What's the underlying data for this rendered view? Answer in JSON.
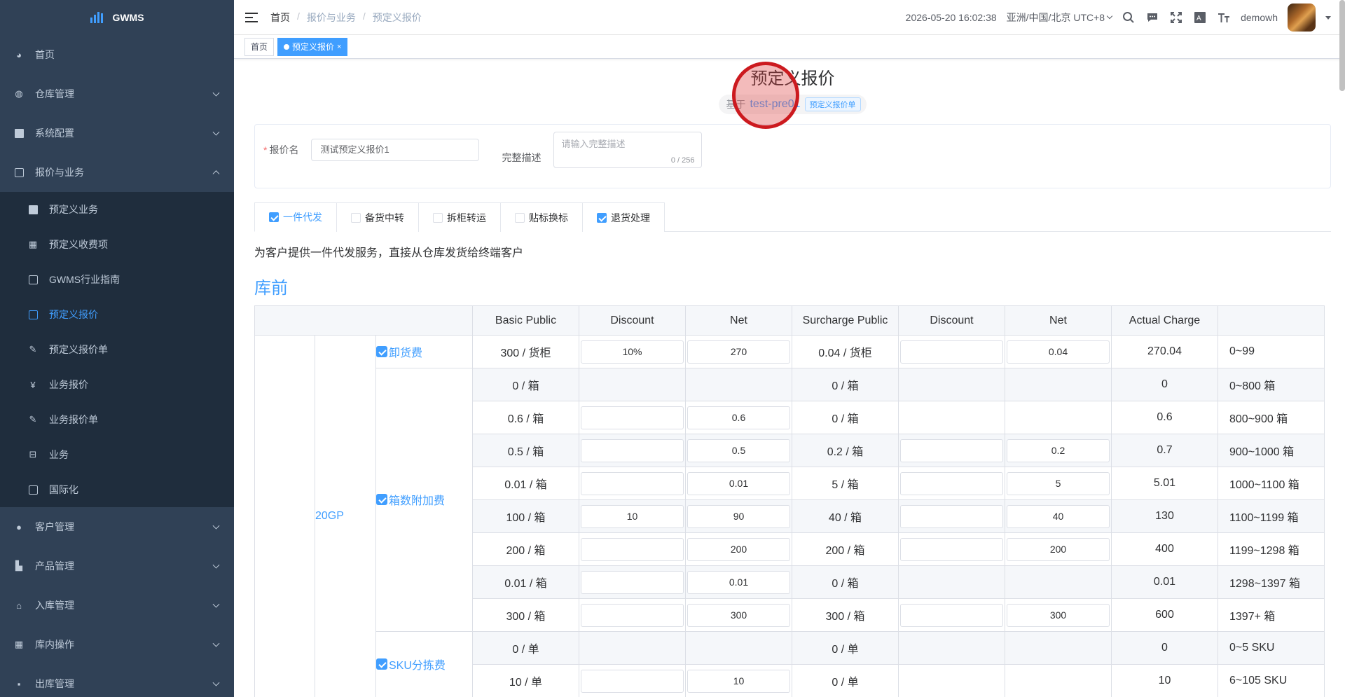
{
  "app": {
    "logo_text": "GWMS"
  },
  "sidebar": {
    "items": [
      {
        "label": "首页",
        "icon": "dashboard-icon",
        "expanded": null
      },
      {
        "label": "仓库管理",
        "icon": "globe-icon",
        "expanded": false
      },
      {
        "label": "系统配置",
        "icon": "server-icon",
        "expanded": false
      },
      {
        "label": "报价与业务",
        "icon": "document-icon",
        "expanded": true
      }
    ],
    "sub_items": [
      {
        "label": "预定义业务",
        "icon": "calendar-icon"
      },
      {
        "label": "预定义收费项",
        "icon": "grid-icon"
      },
      {
        "label": "GWMS行业指南",
        "icon": "document-icon"
      },
      {
        "label": "预定义报价",
        "icon": "document-icon",
        "active": true
      },
      {
        "label": "预定义报价单",
        "icon": "edit-icon"
      },
      {
        "label": "业务报价",
        "icon": "yen-icon"
      },
      {
        "label": "业务报价单",
        "icon": "edit-icon"
      },
      {
        "label": "业务",
        "icon": "briefcase-icon"
      },
      {
        "label": "国际化",
        "icon": "image-icon"
      }
    ],
    "items_after": [
      {
        "label": "客户管理",
        "icon": "user-icon"
      },
      {
        "label": "产品管理",
        "icon": "cart-icon"
      },
      {
        "label": "入库管理",
        "icon": "home-icon"
      },
      {
        "label": "库内操作",
        "icon": "grid-icon"
      },
      {
        "label": "出库管理",
        "icon": "apps-icon"
      }
    ]
  },
  "header": {
    "breadcrumb": [
      "首页",
      "报价与业务",
      "预定义报价"
    ],
    "datetime": "2026-05-20 16:02:38",
    "timezone": "亚洲/中国/北京 UTC+8",
    "username": "demowh"
  },
  "tags_view": {
    "home": "首页",
    "active": "预定义报价"
  },
  "page": {
    "title": "预定义报价",
    "based_label": "基于",
    "based_link": "test-pre01",
    "based_tag": "预定义报价单"
  },
  "form": {
    "name_label": "报价名",
    "name_value": "测试预定义报价1",
    "desc_label": "完整描述",
    "desc_placeholder": "请输入完整描述",
    "desc_count": "0 / 256"
  },
  "tabs": [
    {
      "label": "一件代发",
      "checked": true,
      "active": true
    },
    {
      "label": "备货中转",
      "checked": false
    },
    {
      "label": "拆柜转运",
      "checked": false
    },
    {
      "label": "贴标换标",
      "checked": false
    },
    {
      "label": "退货处理",
      "checked": true
    }
  ],
  "service_description": "为客户提供一件代发服务，直接从仓库发货给终端客户",
  "section_title": "库前",
  "table": {
    "headers": [
      "Basic Public",
      "Discount",
      "Net",
      "Surcharge Public",
      "Discount",
      "Net",
      "Actual Charge"
    ],
    "container": "20GP",
    "groups": [
      {
        "name": "卸货费",
        "rows": [
          {
            "basic": "300 / 货柜",
            "discount": "10%",
            "net": "270",
            "surcharge": "0.04 / 货柜",
            "s_discount": "",
            "s_net": "0.04",
            "actual": "270.04",
            "range": "0~99",
            "inputs": true,
            "s_inputs": true
          }
        ]
      },
      {
        "name": "箱数附加费",
        "rows": [
          {
            "basic": "0 / 箱",
            "discount": "",
            "net": "",
            "surcharge": "0 / 箱",
            "s_discount": "",
            "s_net": "",
            "actual": "0",
            "range": "0~800 箱",
            "inputs": false,
            "s_inputs": false
          },
          {
            "basic": "0.6 / 箱",
            "discount": "",
            "net": "0.6",
            "surcharge": "0 / 箱",
            "s_discount": "",
            "s_net": "",
            "actual": "0.6",
            "range": "800~900 箱",
            "inputs": true,
            "s_inputs": false
          },
          {
            "basic": "0.5 / 箱",
            "discount": "",
            "net": "0.5",
            "surcharge": "0.2 / 箱",
            "s_discount": "",
            "s_net": "0.2",
            "actual": "0.7",
            "range": "900~1000 箱",
            "inputs": true,
            "s_inputs": true
          },
          {
            "basic": "0.01 / 箱",
            "discount": "",
            "net": "0.01",
            "surcharge": "5 / 箱",
            "s_discount": "",
            "s_net": "5",
            "actual": "5.01",
            "range": "1000~1100 箱",
            "inputs": true,
            "s_inputs": true
          },
          {
            "basic": "100 / 箱",
            "discount": "10",
            "net": "90",
            "surcharge": "40 / 箱",
            "s_discount": "",
            "s_net": "40",
            "actual": "130",
            "range": "1100~1199 箱",
            "inputs": true,
            "s_inputs": true
          },
          {
            "basic": "200 / 箱",
            "discount": "",
            "net": "200",
            "surcharge": "200 / 箱",
            "s_discount": "",
            "s_net": "200",
            "actual": "400",
            "range": "1199~1298 箱",
            "inputs": true,
            "s_inputs": true
          },
          {
            "basic": "0.01 / 箱",
            "discount": "",
            "net": "0.01",
            "surcharge": "0 / 箱",
            "s_discount": "",
            "s_net": "",
            "actual": "0.01",
            "range": "1298~1397 箱",
            "inputs": true,
            "s_inputs": false
          },
          {
            "basic": "300 / 箱",
            "discount": "",
            "net": "300",
            "surcharge": "300 / 箱",
            "s_discount": "",
            "s_net": "300",
            "actual": "600",
            "range": "1397+ 箱",
            "inputs": true,
            "s_inputs": true
          }
        ]
      },
      {
        "name": "SKU分拣费",
        "rows": [
          {
            "basic": "0 / 单",
            "discount": "",
            "net": "",
            "surcharge": "0 / 单",
            "s_discount": "",
            "s_net": "",
            "actual": "0",
            "range": "0~5 SKU",
            "inputs": false,
            "s_inputs": false
          },
          {
            "basic": "10 / 单",
            "discount": "",
            "net": "10",
            "surcharge": "0 / 单",
            "s_discount": "",
            "s_net": "",
            "actual": "10",
            "range": "6~105 SKU",
            "inputs": true,
            "s_inputs": false
          }
        ]
      }
    ]
  }
}
